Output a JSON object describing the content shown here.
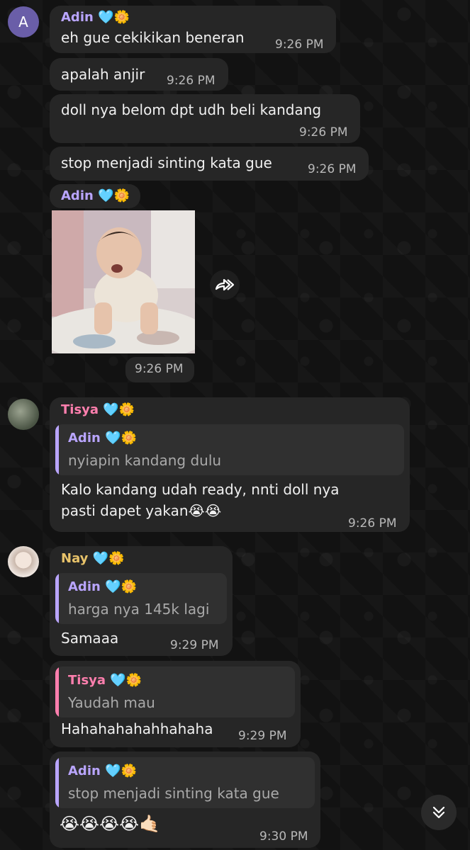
{
  "colors": {
    "background": "#121212",
    "bubble": "#262626",
    "adin": "#b9a5ff",
    "tisya": "#ff7fae",
    "nay": "#e8c36a"
  },
  "messages": {
    "m1": {
      "avatar_letter": "A",
      "sender": "Adin",
      "sender_emoji": "🩵🌼",
      "text": "eh gue cekikikan beneran",
      "time": "9:26 PM"
    },
    "m2": {
      "text": "apalah anjir",
      "time": "9:26 PM"
    },
    "m3": {
      "text": "doll nya belom dpt udh beli kandang",
      "time": "9:26 PM"
    },
    "m4": {
      "text": "stop menjadi sinting kata gue",
      "time": "9:26 PM"
    },
    "m5": {
      "sender": "Adin",
      "sender_emoji": "🩵🌼",
      "time": "9:26 PM",
      "media": "crying baby photo"
    },
    "m6": {
      "sender": "Tisya",
      "sender_emoji": "🩵🌼",
      "reply_name": "Adin",
      "reply_emoji": "🩵🌼",
      "reply_text": "nyiapin kandang dulu",
      "text_line1": "Kalo kandang udah ready, nnti doll nya",
      "text_line2": "pasti dapet yakan😭😭",
      "time": "9:26 PM"
    },
    "m7": {
      "sender": "Nay",
      "sender_emoji": "🩵🌼",
      "reply_name": "Adin",
      "reply_emoji": "🩵🌼",
      "reply_text": "harga nya 145k lagi",
      "text": "Samaaa",
      "time": "9:29 PM"
    },
    "m8": {
      "reply_name": "Tisya",
      "reply_emoji": "🩵🌼",
      "reply_text": "Yaudah mau",
      "text": "Hahahahahahhahaha",
      "time": "9:29 PM"
    },
    "m9": {
      "reply_name": "Adin",
      "reply_emoji": "🩵🌼",
      "reply_text": "stop menjadi sinting kata gue",
      "text": "😭😭😭😭🤙🏻",
      "time": "9:30 PM"
    }
  },
  "icons": {
    "share": "forward-icon",
    "scroll": "scroll-down-icon"
  }
}
